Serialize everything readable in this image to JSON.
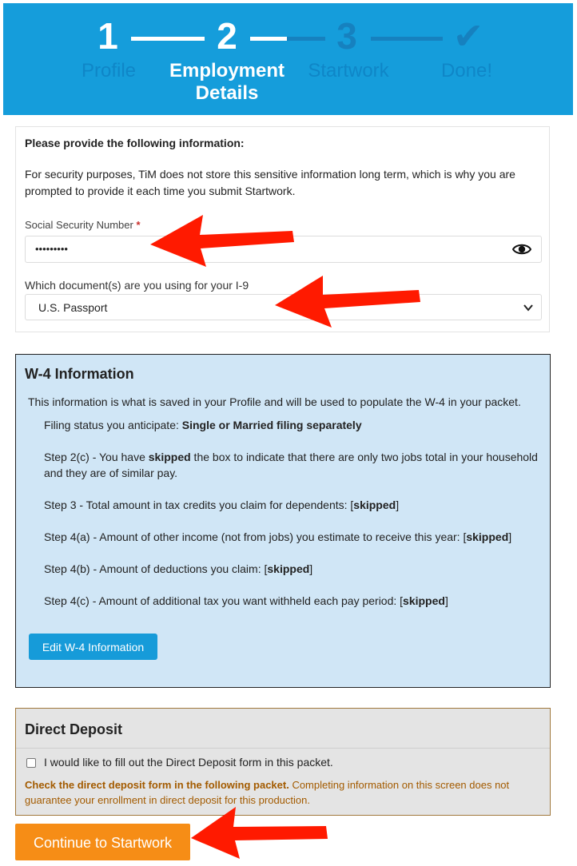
{
  "stepper": {
    "steps": [
      {
        "number": "1",
        "label": "Profile"
      },
      {
        "number": "2",
        "label_line1": "Employment",
        "label_line2": "Details"
      },
      {
        "number": "3",
        "label": "Startwork"
      },
      {
        "number": "✔",
        "label": "Done!"
      }
    ]
  },
  "info_panel": {
    "heading": "Please provide the following information:",
    "paragraph": "For security purposes, TiM does not store this sensitive information long term, which is why you are prompted to provide it each time you submit Startwork.",
    "ssn_label": "Social Security Number",
    "required_mark": "*",
    "ssn_value": "•••••••••",
    "i9_label": "Which document(s) are you using for your I-9",
    "i9_selected": "U.S. Passport"
  },
  "w4": {
    "title": "W-4 Information",
    "intro": "This information is what is saved in your Profile and will be used to populate the W-4 in your packet.",
    "filing_prefix": "Filing status you anticipate: ",
    "filing_value": "Single or Married filing separately",
    "step2c_prefix": "Step 2(c) - You have ",
    "step2c_bold": "skipped",
    "step2c_suffix": " the box to indicate that there are only two jobs total in your household and they are of similar pay.",
    "step3_prefix": "Step 3 - Total amount in tax credits you claim for dependents: [",
    "step4a_prefix": "Step 4(a) - Amount of other income (not from jobs) you estimate to receive this year: [",
    "step4b_prefix": "Step 4(b) - Amount of deductions you claim: [",
    "step4c_prefix": "Step 4(c) - Amount of additional tax you want withheld each pay period: [",
    "skipped": "skipped",
    "close_bracket": "]",
    "edit_button": "Edit W-4 Information"
  },
  "direct_deposit": {
    "title": "Direct Deposit",
    "checkbox_label": "I would like to fill out the Direct Deposit form in this packet.",
    "checked": false,
    "warning_bold": "Check the direct deposit form in the following packet.",
    "warning_text": " Completing information on this screen does not guarantee your enrollment in direct deposit for this production."
  },
  "continue_button": "Continue to Startwork",
  "colors": {
    "header_blue": "#159ddb",
    "w4_bg": "#d0e6f6",
    "button_blue": "#169bd9",
    "continue_orange": "#f68d16",
    "arrow_red": "#ff1a00",
    "warning_brown": "#a35b00"
  }
}
